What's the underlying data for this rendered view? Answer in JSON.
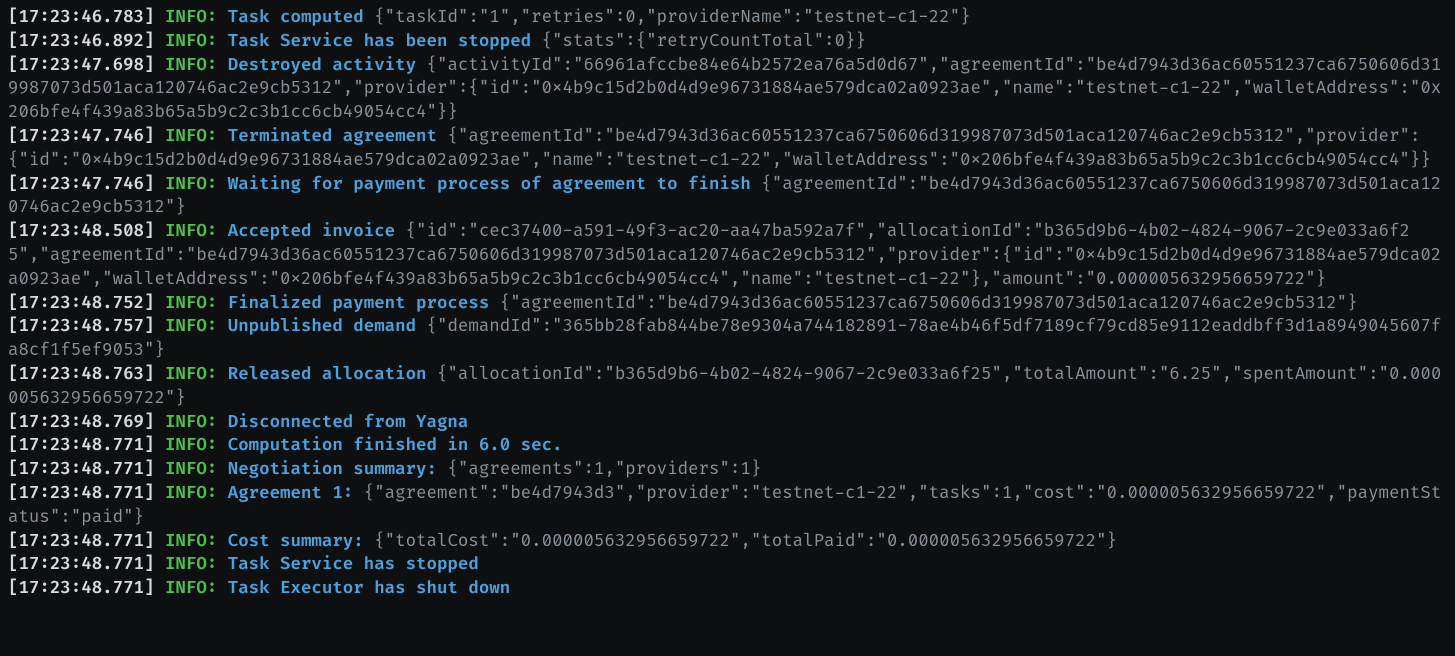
{
  "logs": [
    {
      "ts": "[17:23:46.783]",
      "level": "INFO",
      "msg": "Task computed",
      "json": "{\"taskId\":\"1\",\"retries\":0,\"providerName\":\"testnet-c1-22\"}"
    },
    {
      "ts": "[17:23:46.892]",
      "level": "INFO",
      "msg": "Task Service has been stopped",
      "json": "{\"stats\":{\"retryCountTotal\":0}}"
    },
    {
      "ts": "[17:23:47.698]",
      "level": "INFO",
      "msg": "Destroyed activity",
      "json": "{\"activityId\":\"66961afccbe84e64b2572ea76a5d0d67\",\"agreementId\":\"be4d7943d36ac60551237ca6750606d319987073d501aca120746ac2e9cb5312\",\"provider\":{\"id\":\"0x4b9c15d2b0d4d9e96731884ae579dca02a0923ae\",\"name\":\"testnet-c1-22\",\"walletAddress\":\"0x206bfe4f439a83b65a5b9c2c3b1cc6cb49054cc4\"}}"
    },
    {
      "ts": "[17:23:47.746]",
      "level": "INFO",
      "msg": "Terminated agreement",
      "json": "{\"agreementId\":\"be4d7943d36ac60551237ca6750606d319987073d501aca120746ac2e9cb5312\",\"provider\":{\"id\":\"0x4b9c15d2b0d4d9e96731884ae579dca02a0923ae\",\"name\":\"testnet-c1-22\",\"walletAddress\":\"0x206bfe4f439a83b65a5b9c2c3b1cc6cb49054cc4\"}}"
    },
    {
      "ts": "[17:23:47.746]",
      "level": "INFO",
      "msg": "Waiting for payment process of agreement to finish",
      "json": "{\"agreementId\":\"be4d7943d36ac60551237ca6750606d319987073d501aca120746ac2e9cb5312\"}"
    },
    {
      "ts": "[17:23:48.508]",
      "level": "INFO",
      "msg": "Accepted invoice",
      "json": "{\"id\":\"cec37400-a591-49f3-ac20-aa47ba592a7f\",\"allocationId\":\"b365d9b6-4b02-4824-9067-2c9e033a6f25\",\"agreementId\":\"be4d7943d36ac60551237ca6750606d319987073d501aca120746ac2e9cb5312\",\"provider\":{\"id\":\"0x4b9c15d2b0d4d9e96731884ae579dca02a0923ae\",\"walletAddress\":\"0x206bfe4f439a83b65a5b9c2c3b1cc6cb49054cc4\",\"name\":\"testnet-c1-22\"},\"amount\":\"0.000005632956659722\"}"
    },
    {
      "ts": "[17:23:48.752]",
      "level": "INFO",
      "msg": "Finalized payment process",
      "json": "{\"agreementId\":\"be4d7943d36ac60551237ca6750606d319987073d501aca120746ac2e9cb5312\"}"
    },
    {
      "ts": "[17:23:48.757]",
      "level": "INFO",
      "msg": "Unpublished demand",
      "json": "{\"demandId\":\"365bb28fab844be78e9304a744182891-78ae4b46f5df7189cf79cd85e9112eaddbff3d1a8949045607fa8cf1f5ef9053\"}"
    },
    {
      "ts": "[17:23:48.763]",
      "level": "INFO",
      "msg": "Released allocation",
      "json": "{\"allocationId\":\"b365d9b6-4b02-4824-9067-2c9e033a6f25\",\"totalAmount\":\"6.25\",\"spentAmount\":\"0.000005632956659722\"}"
    },
    {
      "ts": "[17:23:48.769]",
      "level": "INFO",
      "msg": "Disconnected from Yagna",
      "json": ""
    },
    {
      "ts": "[17:23:48.771]",
      "level": "INFO",
      "msg": "Computation finished in 6.0 sec.",
      "json": ""
    },
    {
      "ts": "[17:23:48.771]",
      "level": "INFO",
      "msg": "Negotiation summary:",
      "json": "{\"agreements\":1,\"providers\":1}"
    },
    {
      "ts": "[17:23:48.771]",
      "level": "INFO",
      "msg": "Agreement 1:",
      "json": "{\"agreement\":\"be4d7943d3\",\"provider\":\"testnet-c1-22\",\"tasks\":1,\"cost\":\"0.000005632956659722\",\"paymentStatus\":\"paid\"}"
    },
    {
      "ts": "[17:23:48.771]",
      "level": "INFO",
      "msg": "Cost summary:",
      "json": "{\"totalCost\":\"0.000005632956659722\",\"totalPaid\":\"0.000005632956659722\"}"
    },
    {
      "ts": "[17:23:48.771]",
      "level": "INFO",
      "msg": "Task Service has stopped",
      "json": ""
    },
    {
      "ts": "[17:23:48.771]",
      "level": "INFO",
      "msg": "Task Executor has shut down",
      "json": ""
    }
  ]
}
